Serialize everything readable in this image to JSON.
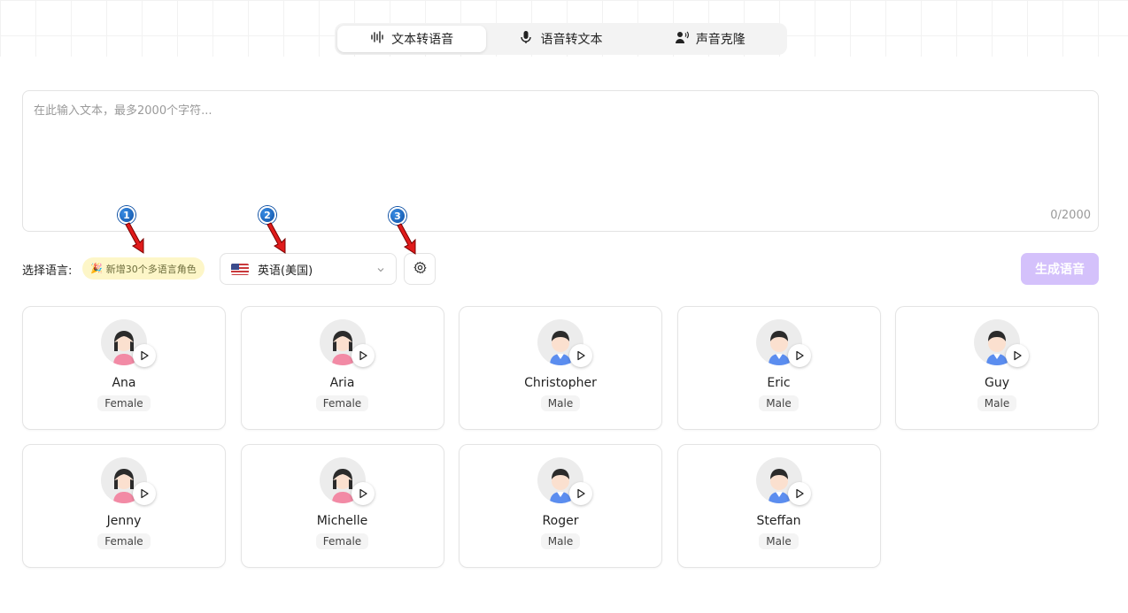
{
  "tabs": [
    {
      "label": "文本转语音",
      "icon": "waveform-icon",
      "active": true
    },
    {
      "label": "语音转文本",
      "icon": "microphone-icon",
      "active": false
    },
    {
      "label": "声音克隆",
      "icon": "voice-clone-icon",
      "active": false
    }
  ],
  "text_input": {
    "placeholder": "在此输入文本，最多2000个字符...",
    "value": "",
    "counter": "0/2000"
  },
  "controls": {
    "language_label": "选择语言:",
    "promo_badge": "新增30个多语言角色",
    "language_select": {
      "selected": "英语(美国)",
      "flag": "us-flag-icon"
    },
    "settings_icon": "gear-icon",
    "generate_button": "生成语音",
    "generate_button_color": "#d4c1fb"
  },
  "annotations": [
    "1",
    "2",
    "3"
  ],
  "voices": [
    {
      "name": "Ana",
      "gender": "Female"
    },
    {
      "name": "Aria",
      "gender": "Female"
    },
    {
      "name": "Christopher",
      "gender": "Male"
    },
    {
      "name": "Eric",
      "gender": "Male"
    },
    {
      "name": "Guy",
      "gender": "Male"
    },
    {
      "name": "Jenny",
      "gender": "Female"
    },
    {
      "name": "Michelle",
      "gender": "Female"
    },
    {
      "name": "Roger",
      "gender": "Male"
    },
    {
      "name": "Steffan",
      "gender": "Male"
    }
  ]
}
